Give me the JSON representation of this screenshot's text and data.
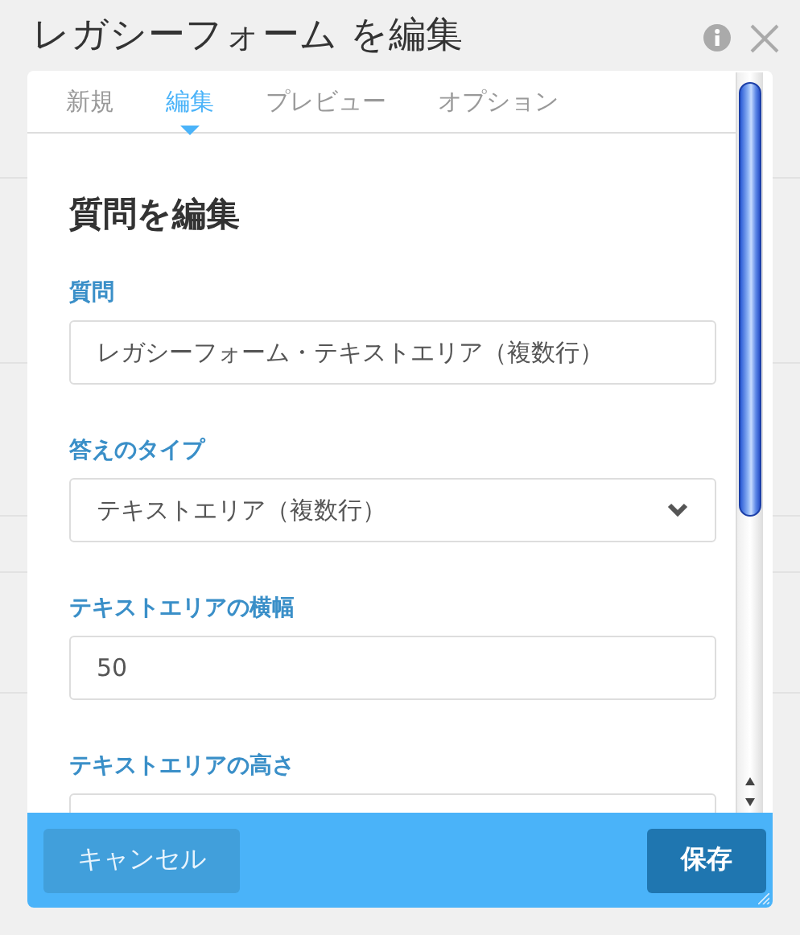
{
  "dialog": {
    "title": "レガシーフォーム を編集",
    "tabs": [
      {
        "label": "新規",
        "selected": false
      },
      {
        "label": "編集",
        "selected": true
      },
      {
        "label": "プレビュー",
        "selected": false
      },
      {
        "label": "オプション",
        "selected": false
      }
    ],
    "heading": "質問を編集",
    "fields": [
      {
        "label": "質問",
        "kind": "text",
        "value": "レガシーフォーム・テキストエリア（複数行）"
      },
      {
        "label": "答えのタイプ",
        "kind": "select",
        "value": "テキストエリア（複数行）"
      },
      {
        "label": "テキストエリアの横幅",
        "kind": "text",
        "value": "50"
      },
      {
        "label": "テキストエリアの高さ",
        "kind": "text"
      }
    ],
    "buttons": [
      {
        "label": "キャンセル",
        "kind": "secondary"
      },
      {
        "label": "保存",
        "kind": "primary"
      }
    ]
  }
}
